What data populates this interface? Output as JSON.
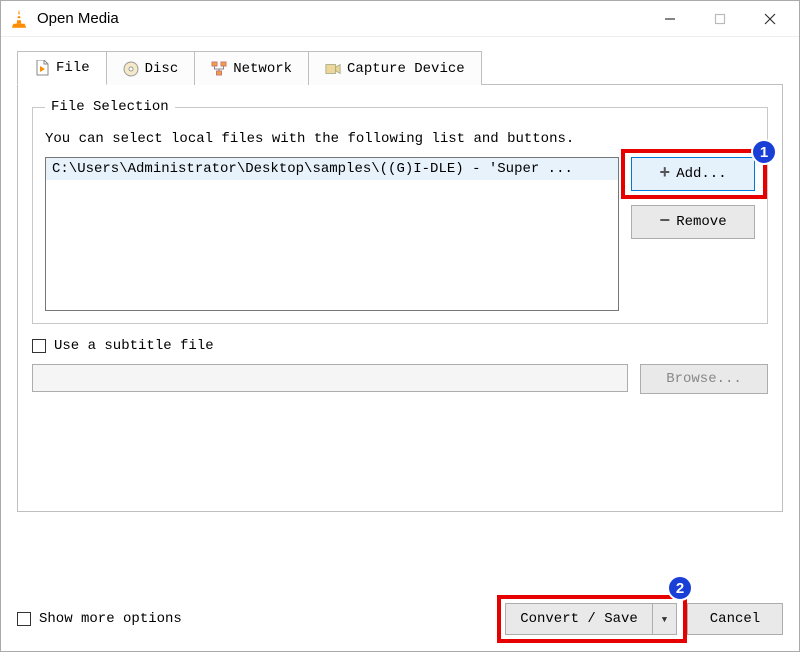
{
  "window": {
    "title": "Open Media"
  },
  "tabs": {
    "file": "File",
    "disc": "Disc",
    "network": "Network",
    "capture": "Capture Device"
  },
  "file_selection": {
    "legend": "File Selection",
    "hint": "You can select local files with the following list and buttons.",
    "items": [
      "C:\\Users\\Administrator\\Desktop\\samples\\((G)I-DLE) - 'Super ..."
    ],
    "add_label": "Add...",
    "remove_label": "Remove"
  },
  "subtitle": {
    "checkbox_label": "Use a subtitle file",
    "browse_label": "Browse..."
  },
  "footer": {
    "show_more": "Show more options",
    "convert_label": "Convert / Save",
    "cancel_label": "Cancel"
  },
  "annotations": {
    "badge1": "1",
    "badge2": "2"
  }
}
